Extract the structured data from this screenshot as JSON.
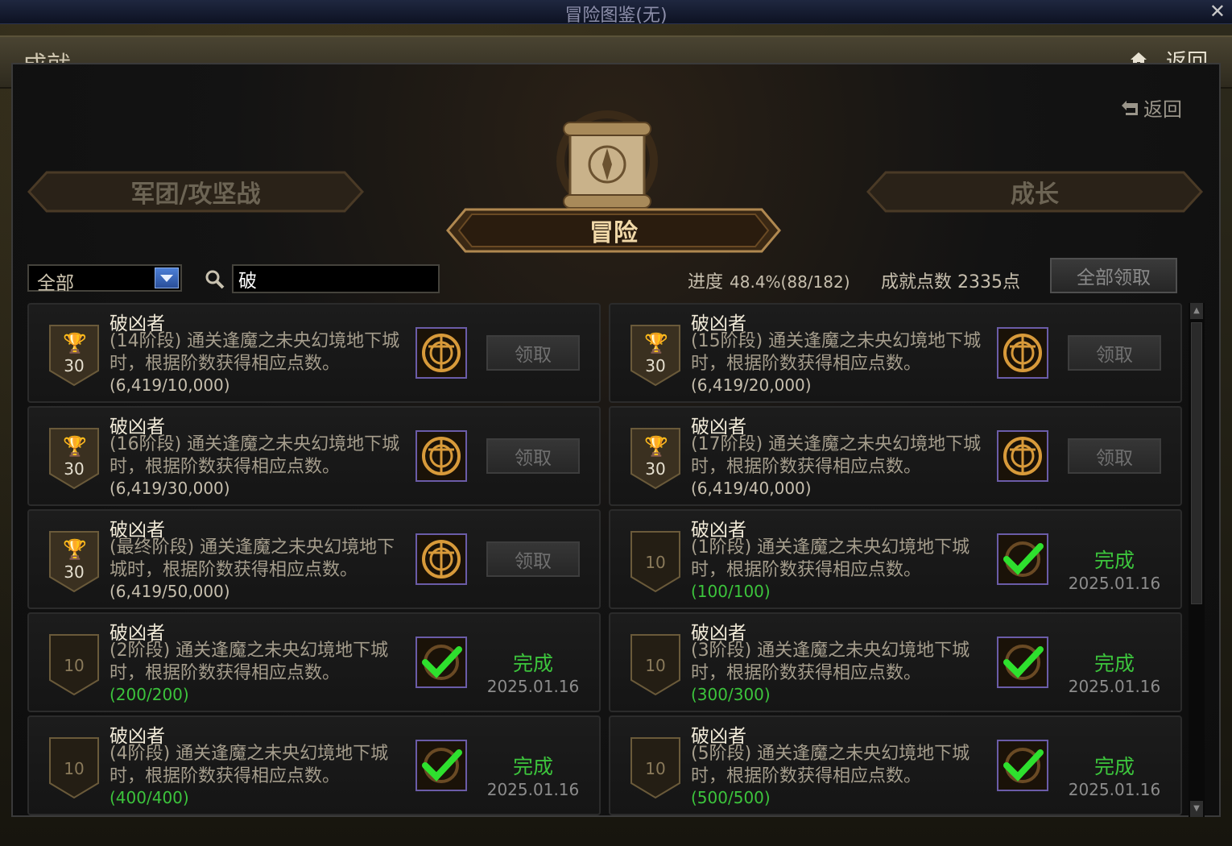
{
  "window": {
    "title": "冒险图鉴(无)",
    "close": "✕"
  },
  "header": {
    "title": "成就",
    "back_label": "返回"
  },
  "sub_back_label": "返回",
  "categories": {
    "left": "军团/攻坚战",
    "center": "冒险",
    "right": "成长"
  },
  "filter": {
    "selected": "全部",
    "search_value": "破"
  },
  "progress": {
    "label": "进度",
    "value": "48.4%(88/182)"
  },
  "points": {
    "text": "成就点数 2335点"
  },
  "claim_all_label": "全部领取",
  "achievements": [
    {
      "name": "破凶者",
      "points": "30",
      "desc": "(14阶段) 通关逢魔之未央幻境地下城时，根据阶数获得相应点数。",
      "progress": "(6,419/10,000)",
      "state": "claim",
      "claim_label": "领取"
    },
    {
      "name": "破凶者",
      "points": "30",
      "desc": "(15阶段) 通关逢魔之未央幻境地下城时，根据阶数获得相应点数。",
      "progress": "(6,419/20,000)",
      "state": "claim",
      "claim_label": "领取"
    },
    {
      "name": "破凶者",
      "points": "30",
      "desc": "(16阶段) 通关逢魔之未央幻境地下城时，根据阶数获得相应点数。",
      "progress": "(6,419/30,000)",
      "state": "claim",
      "claim_label": "领取"
    },
    {
      "name": "破凶者",
      "points": "30",
      "desc": "(17阶段) 通关逢魔之未央幻境地下城时，根据阶数获得相应点数。",
      "progress": "(6,419/40,000)",
      "state": "claim",
      "claim_label": "领取"
    },
    {
      "name": "破凶者",
      "points": "30",
      "desc": "(最终阶段) 通关逢魔之未央幻境地下城时，根据阶数获得相应点数。",
      "progress": "(6,419/50,000)",
      "state": "claim",
      "claim_label": "领取"
    },
    {
      "name": "破凶者",
      "points": "10",
      "desc": "(1阶段) 通关逢魔之未央幻境地下城时，根据阶数获得相应点数。",
      "progress": "(100/100)",
      "state": "done",
      "status_label": "完成",
      "date": "2025.01.16"
    },
    {
      "name": "破凶者",
      "points": "10",
      "desc": "(2阶段) 通关逢魔之未央幻境地下城时，根据阶数获得相应点数。",
      "progress": "(200/200)",
      "state": "done",
      "status_label": "完成",
      "date": "2025.01.16"
    },
    {
      "name": "破凶者",
      "points": "10",
      "desc": "(3阶段) 通关逢魔之未央幻境地下城时，根据阶数获得相应点数。",
      "progress": "(300/300)",
      "state": "done",
      "status_label": "完成",
      "date": "2025.01.16"
    },
    {
      "name": "破凶者",
      "points": "10",
      "desc": "(4阶段) 通关逢魔之未央幻境地下城时，根据阶数获得相应点数。",
      "progress": "(400/400)",
      "state": "done",
      "status_label": "完成",
      "date": "2025.01.16"
    },
    {
      "name": "破凶者",
      "points": "10",
      "desc": "(5阶段) 通关逢魔之未央幻境地下城时，根据阶数获得相应点数。",
      "progress": "(500/500)",
      "state": "done",
      "status_label": "完成",
      "date": "2025.01.16"
    }
  ],
  "colors": {
    "accent_gold": "#f0d8a8",
    "complete_green": "#3cc43c",
    "dropdown_blue": "#2a4f9a",
    "reward_border": "#6b5ca8"
  },
  "icons": {
    "home": "home-icon",
    "back": "return-arrow-icon",
    "search": "search-icon",
    "trophy": "trophy-icon",
    "reward": "emblem-reward-icon",
    "check": "check-icon"
  }
}
